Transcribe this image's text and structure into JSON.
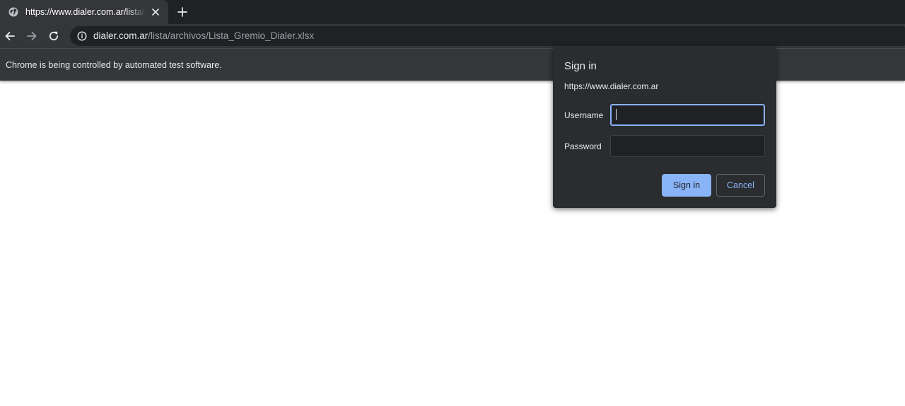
{
  "tab": {
    "title": "https://www.dialer.com.ar/lista/archivos/Lista_Gremio_Dialer.xlsx",
    "icon": "globe-icon"
  },
  "omnibox": {
    "host": "dialer.com.ar",
    "path": "/lista/archivos/Lista_Gremio_Dialer.xlsx"
  },
  "infobar": {
    "message": "Chrome is being controlled by automated test software."
  },
  "signin_dialog": {
    "title": "Sign in",
    "origin": "https://www.dialer.com.ar",
    "username_label": "Username",
    "username_value": "",
    "password_label": "Password",
    "password_value": "",
    "signin_label": "Sign in",
    "cancel_label": "Cancel"
  },
  "colors": {
    "tabstrip_bg": "#202124",
    "toolbar_bg": "#35363a",
    "accent": "#8ab4f8",
    "dialog_bg": "#2b2c30"
  }
}
